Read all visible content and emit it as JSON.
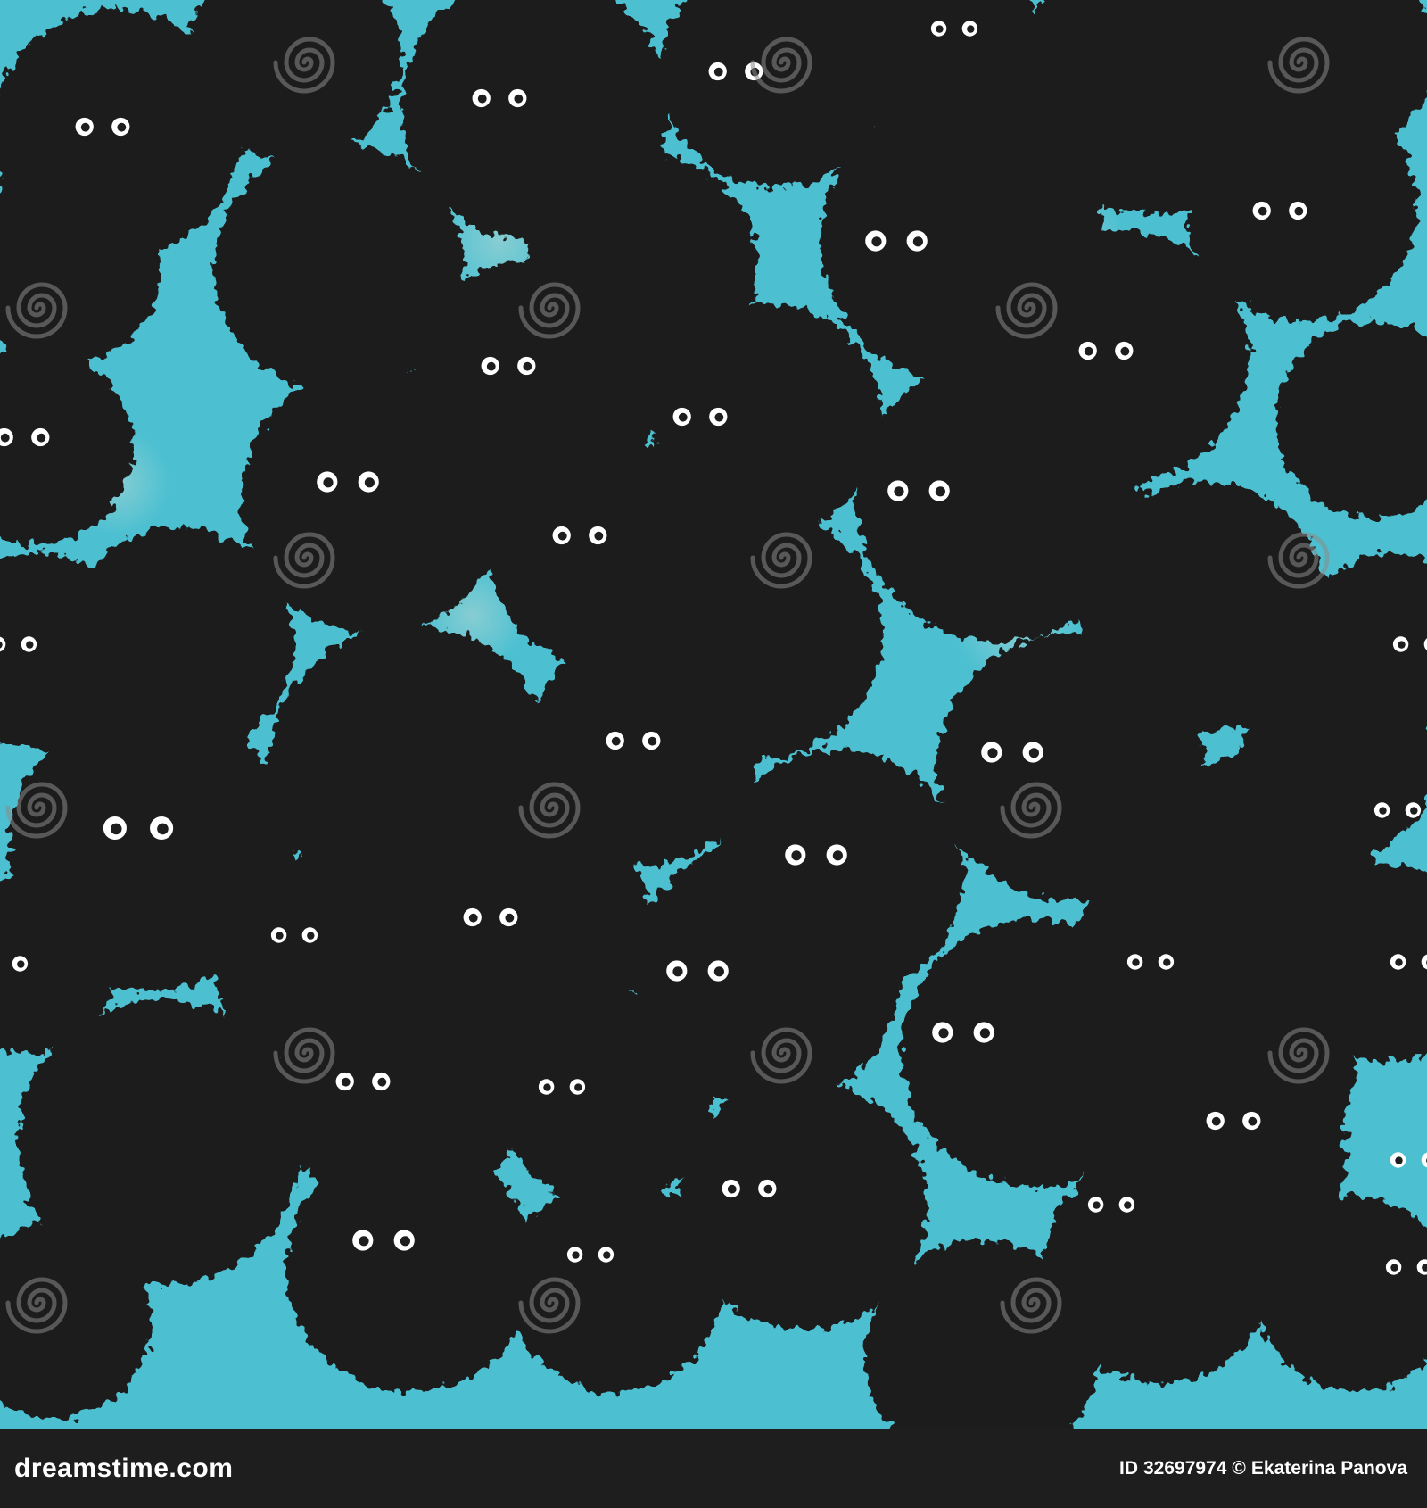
{
  "colors": {
    "background": "#4cc0d1",
    "background_pale": "#8ecfd3",
    "creature": "#1f1e1f",
    "eye_white": "#ffffff",
    "watermark": "#8a8a8a",
    "footer_background": "#1f1e1f",
    "footer_text": "#ffffff"
  },
  "pattern": {
    "description_tag": "seamless fuzzy black creatures with eyes on turquoise",
    "watermark_icon": "spiral-logo-icon",
    "watermark_text": "dreamstime"
  },
  "footer": {
    "site": "dreamstime.com",
    "id_label": "ID",
    "id_value": "32697974",
    "copyright": "©",
    "author": "Ekaterina Panova"
  }
}
